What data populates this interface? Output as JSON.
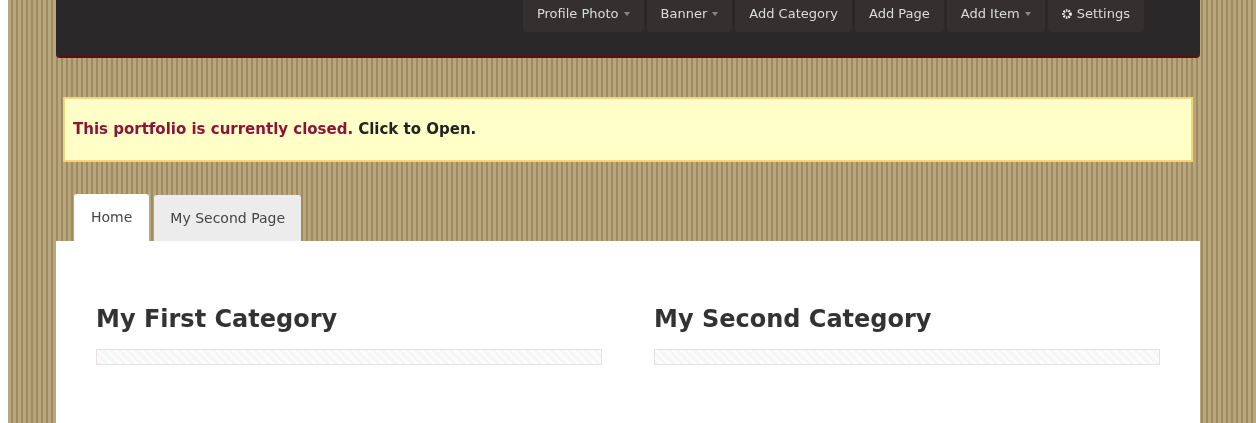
{
  "toolbar": [
    {
      "label": "Profile Photo",
      "dropdown": true,
      "kind": "text"
    },
    {
      "label": "Banner",
      "dropdown": true,
      "kind": "text"
    },
    {
      "label": "Add Category",
      "dropdown": false,
      "kind": "text"
    },
    {
      "label": "Add Page",
      "dropdown": false,
      "kind": "text"
    },
    {
      "label": "Add Item",
      "dropdown": true,
      "kind": "text"
    },
    {
      "label": "Settings",
      "dropdown": false,
      "kind": "gear"
    }
  ],
  "notice": {
    "status": "This portfolio is currently closed.",
    "action": "Click to Open."
  },
  "tabs": [
    {
      "label": "Home",
      "selected": true
    },
    {
      "label": "My Second Page",
      "selected": false
    }
  ],
  "categories": [
    {
      "title": "My First Category"
    },
    {
      "title": "My Second Category"
    }
  ]
}
